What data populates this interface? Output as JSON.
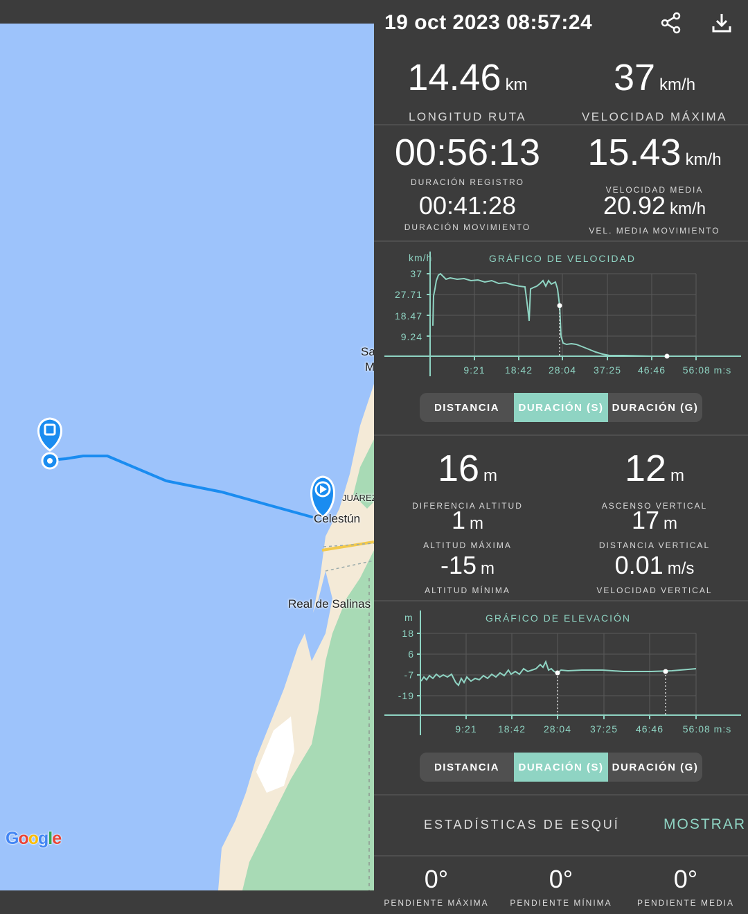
{
  "header": {
    "title": "19 oct 2023 08:57:24"
  },
  "map": {
    "labels": [
      "Sa",
      "M",
      "JUÁREZ",
      "Celestún",
      "Real de Salinas"
    ],
    "google": "Google"
  },
  "stats_top": [
    {
      "value": "14.46",
      "unit": "km",
      "label": "LONGITUD RUTA"
    },
    {
      "value": "37",
      "unit": "km/h",
      "label": "VELOCIDAD MÁXIMA"
    }
  ],
  "stats_duration": [
    {
      "value": "00:56:13",
      "unit": "",
      "label": "DURACIÓN REGISTRO"
    },
    {
      "value": "15.43",
      "unit": "km/h",
      "label": "VELOCIDAD MEDIA"
    },
    {
      "value": "00:41:28",
      "unit": "",
      "label": "DURACIÓN MOVIMIENTO"
    },
    {
      "value": "20.92",
      "unit": "km/h",
      "label": "VEL. MEDIA MOVIMIENTO"
    }
  ],
  "speed_chart": {
    "title": "GRÁFICO DE VELOCIDAD",
    "yunit": "km/h",
    "yticks": [
      "37",
      "27.71",
      "18.47",
      "9.24"
    ],
    "xticks": [
      "9:21",
      "18:42",
      "28:04",
      "37:25",
      "46:46",
      "56:08 m:s"
    ]
  },
  "speed_tabs": [
    "DISTANCIA",
    "DURACIÓN (S)",
    "DURACIÓN (G)"
  ],
  "stats_alt": [
    {
      "value": "16",
      "unit": "m",
      "label": "DIFERENCIA ALTITUD"
    },
    {
      "value": "12",
      "unit": "m",
      "label": "ASCENSO VERTICAL"
    },
    {
      "value": "1",
      "unit": "m",
      "label": "ALTITUD MÁXIMA"
    },
    {
      "value": "17",
      "unit": "m",
      "label": "DISTANCIA VERTICAL"
    },
    {
      "value": "-15",
      "unit": "m",
      "label": "ALTITUD MÍNIMA"
    },
    {
      "value": "0.01",
      "unit": "m/s",
      "label": "VELOCIDAD VERTICAL"
    }
  ],
  "elev_chart": {
    "title": "GRÁFICO DE ELEVACIÓN",
    "yunit": "m",
    "yticks": [
      "18",
      "6",
      "-7",
      "-19"
    ],
    "xticks": [
      "9:21",
      "18:42",
      "28:04",
      "37:25",
      "46:46",
      "56:08 m:s"
    ]
  },
  "elev_tabs": [
    "DISTANCIA",
    "DURACIÓN (S)",
    "DURACIÓN (G)"
  ],
  "ski": {
    "label": "ESTADÍSTICAS DE ESQUÍ",
    "button": "MOSTRAR"
  },
  "slopes": [
    {
      "value": "0°",
      "label": "PENDIENTE MÁXIMA"
    },
    {
      "value": "0°",
      "label": "PENDIENTE MÍNIMA"
    },
    {
      "value": "0°",
      "label": "PENDIENTE MEDIA"
    }
  ],
  "colors": {
    "accent": "#8fd4c3",
    "water": "#9dc3fb",
    "route": "#1a8cf0"
  }
}
